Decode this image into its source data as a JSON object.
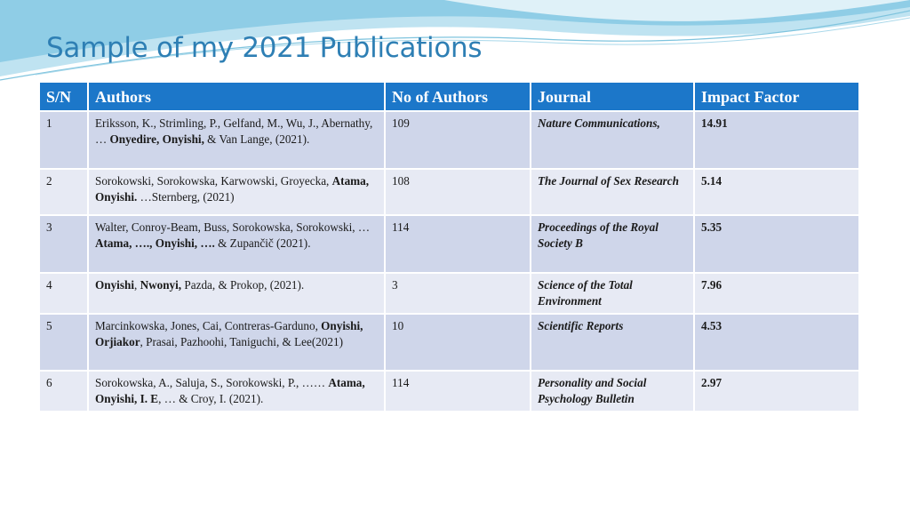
{
  "slide": {
    "title": "Sample of my 2021 Publications"
  },
  "colors": {
    "title": "#2e7fb4",
    "header_bg": "#1c77c9",
    "row_odd": "#cfd6ea",
    "row_even": "#e7eaf4",
    "wave_light": "#bfe3f1",
    "wave_dark": "#8fcde6"
  },
  "table": {
    "headers": [
      "S/N",
      "Authors",
      "No of Authors",
      "Journal",
      "Impact Factor"
    ],
    "rows": [
      {
        "sn": "1",
        "authors": [
          {
            "t": "Eriksson, K., Strimling, P., Gelfand, M., Wu, J., Abernathy, … "
          },
          {
            "t": "Onyedire, Onyishi,",
            "b": true
          },
          {
            "t": "  & Van Lange, (2021)."
          }
        ],
        "count": "109",
        "journal": "Nature Communications,",
        "impact": "14.91"
      },
      {
        "sn": "2",
        "authors": [
          {
            "t": "Sorokowski, Sorokowska, Karwowski, Groyecka, "
          },
          {
            "t": "Atama, Onyishi.",
            "b": true
          },
          {
            "t": " …Sternberg, (2021)"
          }
        ],
        "count": "108",
        "journal": "The Journal of Sex Research",
        "impact": "5.14"
      },
      {
        "sn": "3",
        "authors": [
          {
            "t": "Walter, Conroy-Beam,  Buss, Sorokowska, Sorokowski, … "
          },
          {
            "t": "Atama, …., Onyishi,  ….",
            "b": true
          },
          {
            "t": " & Zupančič (2021)."
          }
        ],
        "count": "114",
        "journal": "Proceedings of the Royal Society B",
        "impact": "5.35"
      },
      {
        "sn": "4",
        "authors": [
          {
            "t": "Onyishi",
            "b": true
          },
          {
            "t": ", "
          },
          {
            "t": "Nwonyi,",
            "b": true
          },
          {
            "t": "  Pazda,  & Prokop, (2021)."
          }
        ],
        "count": "3",
        "journal": "Science of the Total Environment",
        "impact": "7.96"
      },
      {
        "sn": "5",
        "authors": [
          {
            "t": "Marcinkowska, Jones, Cai, Contreras-Garduno, "
          },
          {
            "t": "Onyishi, Orjiakor",
            "b": true
          },
          {
            "t": ", Prasai, Pazhoohi, Taniguchi, & Lee(2021)"
          }
        ],
        "count": "10",
        "journal": "Scientific Reports",
        "impact": "4.53"
      },
      {
        "sn": "6",
        "authors": [
          {
            "t": "Sorokowska, A., Saluja, S., Sorokowski, P., …… "
          },
          {
            "t": "Atama, Onyishi, I. E",
            "b": true
          },
          {
            "t": ", … & Croy, I. (2021)."
          }
        ],
        "count": "114",
        "journal": " Personality and Social Psychology Bulletin",
        "impact": "2.97"
      }
    ]
  }
}
